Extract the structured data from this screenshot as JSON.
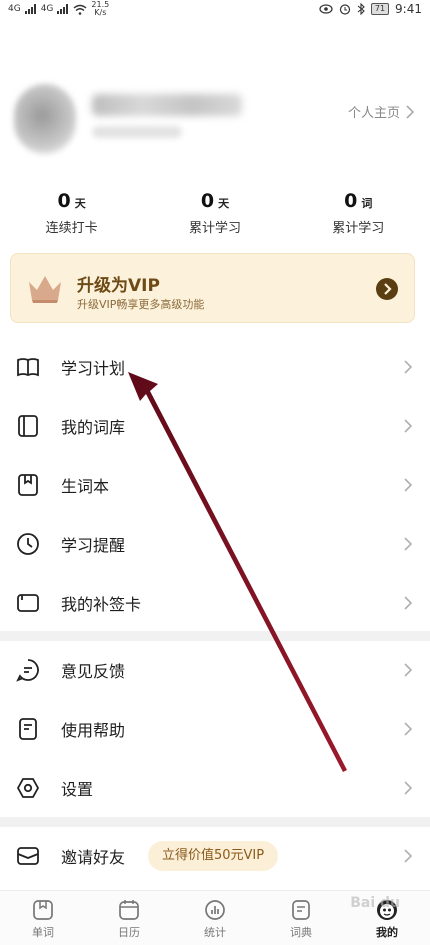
{
  "status_bar": {
    "signal_left": "4G",
    "signal_right": "4G",
    "speed_value": "21.5",
    "speed_unit": "K/s",
    "battery": "71",
    "time": "9:41"
  },
  "profile": {
    "home_link": "个人主页"
  },
  "stats": [
    {
      "value": "0",
      "unit": "天",
      "label": "连续打卡"
    },
    {
      "value": "0",
      "unit": "天",
      "label": "累计学习"
    },
    {
      "value": "0",
      "unit": "词",
      "label": "累计学习"
    }
  ],
  "vip": {
    "title": "升级为VIP",
    "subtitle": "升级VIP畅享更多高级功能"
  },
  "menu": {
    "study_plan": "学习计划",
    "my_wordbank": "我的词库",
    "vocab_book": "生词本",
    "study_reminder": "学习提醒",
    "makeup_card": "我的补签卡",
    "feedback": "意见反馈",
    "help": "使用帮助",
    "settings": "设置",
    "invite": "邀请好友",
    "invite_badge": "立得价值50元VIP"
  },
  "tabs": [
    {
      "label": "单词",
      "icon": "word-card-icon"
    },
    {
      "label": "日历",
      "icon": "calendar-icon"
    },
    {
      "label": "统计",
      "icon": "stats-icon"
    },
    {
      "label": "词典",
      "icon": "dictionary-icon"
    },
    {
      "label": "我的",
      "icon": "avatar-icon"
    }
  ],
  "watermark": "Bai du",
  "colors": {
    "vip_bg": "#fcf1da",
    "vip_text": "#6e4a16",
    "arrow": "#7a1020"
  }
}
